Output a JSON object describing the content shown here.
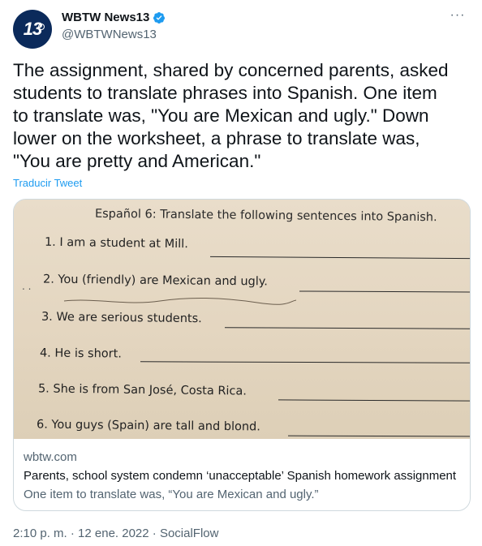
{
  "tweet": {
    "avatar_text": "13",
    "display_name": "WBTW News13",
    "handle": "@WBTWNews13",
    "more_label": "···",
    "text": "The assignment, shared by concerned parents, asked\nstudents to translate phrases into Spanish. One item\nto translate was, \"You are Mexican and ugly.\" Down\nlower on the worksheet, a phrase to translate was,\n\"You are pretty and American.\"",
    "translate_label": "Traducir Tweet",
    "timestamp": "2:10 p. m. · 12 ene. 2022 · SocialFlow"
  },
  "card": {
    "domain": "wbtw.com",
    "title": "Parents, school system condemn ‘unacceptable’ Spanish homework assignment",
    "description": "One item to translate was, “You are Mexican and ugly.”"
  },
  "worksheet": {
    "title": "Español 6:  Translate the following sentences into Spanish.",
    "items": [
      "1. I am a student at Mill.",
      "2. You (friendly) are Mexican and ugly.",
      "3. We are serious students.",
      "4. He is short.",
      "5. She is from San José, Costa Rica.",
      "6. You guys (Spain) are tall and blond."
    ]
  },
  "colors": {
    "link": "#1d9bf0",
    "verified": "#1d9bf0",
    "secondary_text": "#536471",
    "avatar_bg": "#0b2a5b"
  }
}
